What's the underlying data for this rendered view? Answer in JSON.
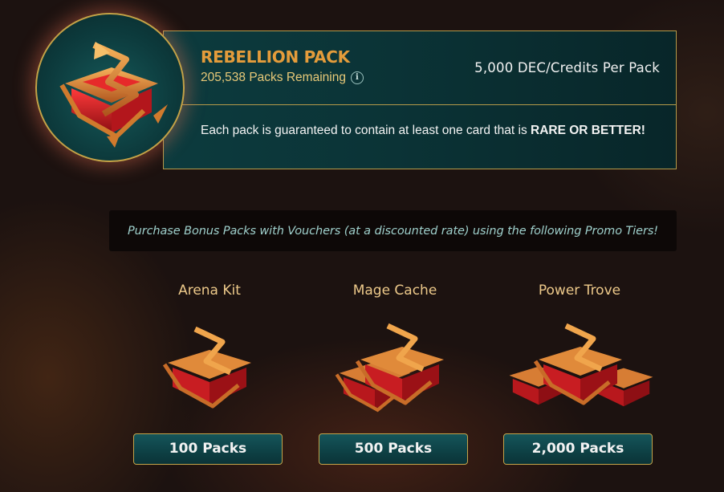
{
  "pack": {
    "title": "REBELLION PACK",
    "remaining": "205,538 Packs Remaining",
    "price": "5,000 DEC/Credits Per Pack",
    "guarantee_text": "Each pack is guaranteed to contain at least one card that is ",
    "guarantee_bold": "RARE OR BETTER!",
    "info_icon": "info-icon",
    "pack_icon": "rebellion-pack-chest"
  },
  "promo": {
    "text": "Purchase Bonus Packs with Vouchers (at a discounted rate) using the following Promo Tiers!"
  },
  "tiers": [
    {
      "name": "Arena Kit",
      "button": "100 Packs",
      "chest_count": 1
    },
    {
      "name": "Mage Cache",
      "button": "500 Packs",
      "chest_count": 2
    },
    {
      "name": "Power Trove",
      "button": "2,000 Packs",
      "chest_count": 3
    }
  ],
  "colors": {
    "title_orange": "#e49c3b",
    "gold_border": "#b59a4a",
    "teal_panel": "#0c3b3e",
    "promo_text": "#9fd0cc"
  }
}
